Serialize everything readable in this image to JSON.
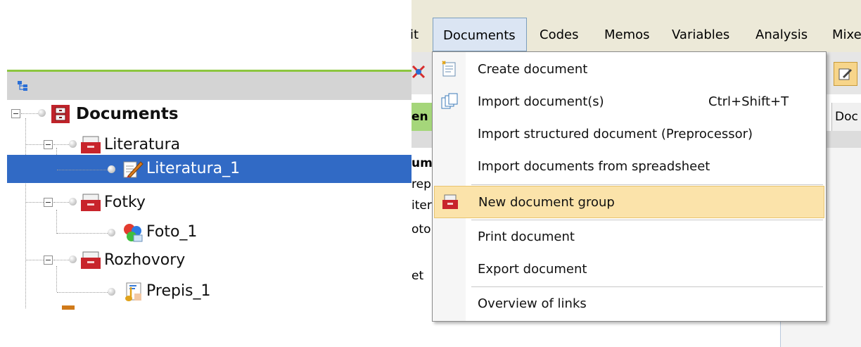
{
  "tree": {
    "root": {
      "label": "Documents"
    },
    "groups": [
      {
        "label": "Literatura",
        "children": [
          "Literatura_1"
        ]
      },
      {
        "label": "Fotky",
        "children": [
          "Foto_1"
        ]
      },
      {
        "label": "Rozhovory",
        "children": [
          "Prepis_1"
        ]
      }
    ]
  },
  "menubar": {
    "items": [
      "it",
      "Documents",
      "Codes",
      "Memos",
      "Variables",
      "Analysis",
      "Mixe"
    ],
    "active": "Documents"
  },
  "background": {
    "toolbar_text": [
      "en",
      "Doc"
    ],
    "content_text": [
      "um",
      "rep",
      "iter",
      "oto",
      "et"
    ]
  },
  "menu": {
    "items": [
      {
        "label": "Create document",
        "shortcut": ""
      },
      {
        "label": "Import document(s)",
        "shortcut": "Ctrl+Shift+T"
      },
      {
        "label": "Import structured document (Preprocessor)",
        "shortcut": ""
      },
      {
        "label": "Import documents from spreadsheet",
        "shortcut": ""
      },
      {
        "label": "New document group",
        "shortcut": "",
        "highlighted": true
      },
      {
        "label": "Print document",
        "shortcut": ""
      },
      {
        "label": "Export document",
        "shortcut": ""
      },
      {
        "label": "Overview of links",
        "shortcut": ""
      }
    ]
  },
  "colors": {
    "selection": "#316ac5",
    "menu_highlight": "#fbe3aa",
    "green_accent": "#8cc63f"
  }
}
